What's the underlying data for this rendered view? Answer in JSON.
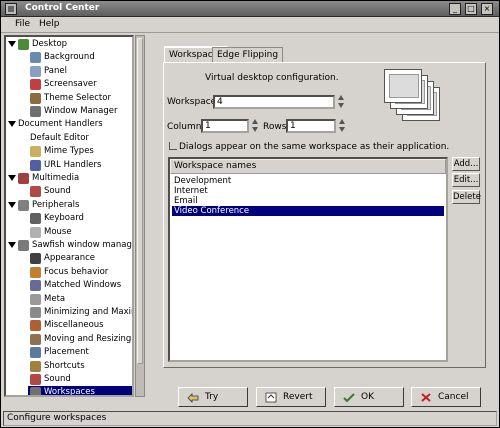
{
  "window": {
    "title": "Control Center"
  },
  "menu": {
    "file": "File",
    "help": "Help"
  },
  "tree": {
    "items": [
      {
        "label": "Desktop",
        "level": 0,
        "expanded": true,
        "icon": "desktop-icon"
      },
      {
        "label": "Background",
        "level": 1,
        "icon": "background-icon"
      },
      {
        "label": "Panel",
        "level": 1,
        "icon": "panel-icon"
      },
      {
        "label": "Screensaver",
        "level": 1,
        "icon": "screensaver-icon"
      },
      {
        "label": "Theme Selector",
        "level": 1,
        "icon": "theme-icon"
      },
      {
        "label": "Window Manager",
        "level": 1,
        "icon": "window-manager-icon"
      },
      {
        "label": "Document Handlers",
        "level": 0,
        "expanded": true,
        "icon": ""
      },
      {
        "label": "Default Editor",
        "level": 1,
        "icon": ""
      },
      {
        "label": "Mime Types",
        "level": 1,
        "icon": "mime-icon"
      },
      {
        "label": "URL Handlers",
        "level": 1,
        "icon": "url-icon"
      },
      {
        "label": "Multimedia",
        "level": 0,
        "expanded": true,
        "icon": "multimedia-icon"
      },
      {
        "label": "Sound",
        "level": 1,
        "icon": "sound-icon"
      },
      {
        "label": "Peripherals",
        "level": 0,
        "expanded": true,
        "icon": "peripherals-icon"
      },
      {
        "label": "Keyboard",
        "level": 1,
        "icon": "keyboard-icon"
      },
      {
        "label": "Mouse",
        "level": 1,
        "icon": "mouse-icon"
      },
      {
        "label": "Sawfish window manager",
        "level": 0,
        "expanded": true,
        "icon": "sawfish-icon"
      },
      {
        "label": "Appearance",
        "level": 1,
        "icon": "appearance-icon"
      },
      {
        "label": "Focus behavior",
        "level": 1,
        "icon": "focus-icon"
      },
      {
        "label": "Matched Windows",
        "level": 1,
        "icon": "matched-icon"
      },
      {
        "label": "Meta",
        "level": 1,
        "icon": "meta-icon"
      },
      {
        "label": "Minimizing and Maximizing",
        "level": 1,
        "icon": "minimize-icon"
      },
      {
        "label": "Miscellaneous",
        "level": 1,
        "icon": "misc-icon"
      },
      {
        "label": "Moving and Resizing",
        "level": 1,
        "icon": "move-icon"
      },
      {
        "label": "Placement",
        "level": 1,
        "icon": "placement-icon"
      },
      {
        "label": "Shortcuts",
        "level": 1,
        "icon": "shortcuts-icon"
      },
      {
        "label": "Sound",
        "level": 1,
        "icon": "sound-icon"
      },
      {
        "label": "Workspaces",
        "level": 1,
        "icon": "workspaces-icon",
        "selected": true
      }
    ]
  },
  "tabs": [
    {
      "label": "Workspaces",
      "active": true
    },
    {
      "label": "Edge Flipping",
      "active": false
    }
  ],
  "workspaces": {
    "description": "Virtual desktop configuration.",
    "workspaces_label": "Workspaces:",
    "workspaces_value": "4",
    "columns_label": "Columns:",
    "columns_value": "1",
    "rows_label": "Rows:",
    "rows_value": "1",
    "dialogs_checkbox": "Dialogs appear on the same workspace as their application.",
    "list_header": "Workspace names",
    "names": [
      "Development",
      "Internet",
      "Email",
      "Video Conference"
    ],
    "selected_index": 3,
    "add": "Add...",
    "edit": "Edit...",
    "delete": "Delete"
  },
  "buttons": {
    "try": "Try",
    "revert": "Revert",
    "ok": "OK",
    "cancel": "Cancel"
  },
  "status": "Configure workspaces",
  "colors": {
    "selection": "#00007b",
    "window_bg": "#d6d3ce"
  }
}
